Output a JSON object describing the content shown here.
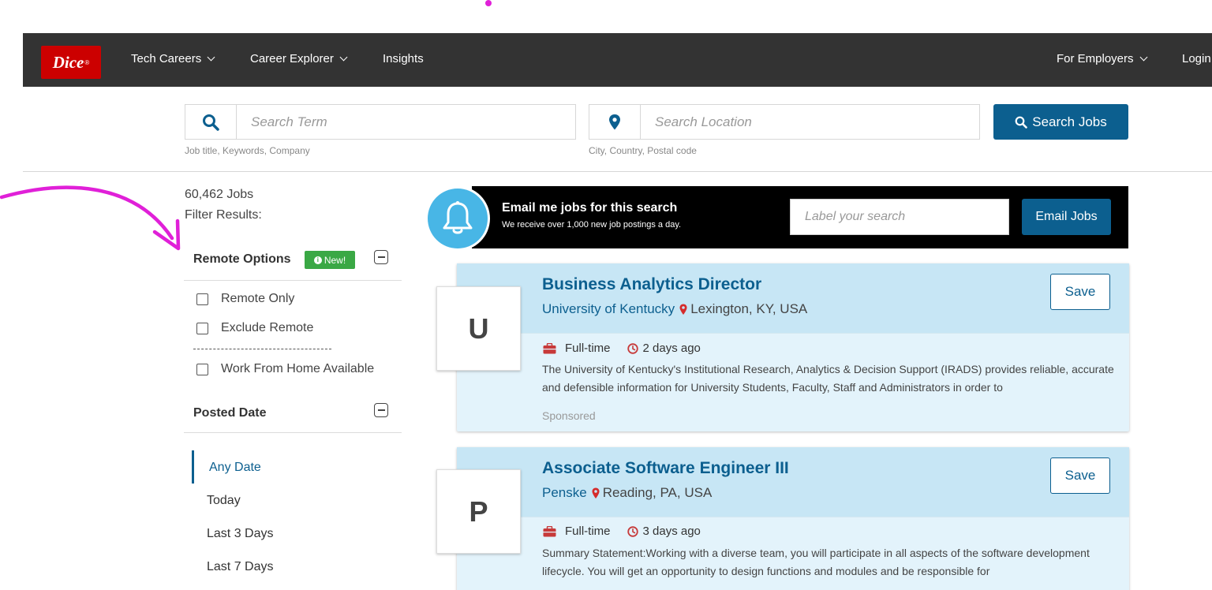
{
  "nav": {
    "logo": "Dice",
    "items": [
      "Tech Careers",
      "Career Explorer",
      "Insights"
    ],
    "right_items": [
      "For Employers",
      "Login"
    ]
  },
  "search": {
    "term_placeholder": "Search Term",
    "term_hint": "Job title, Keywords, Company",
    "location_placeholder": "Search Location",
    "location_hint": "City, Country, Postal code",
    "button_label": "Search Jobs"
  },
  "sidebar": {
    "jobs_count": "60,462 Jobs",
    "filter_label": "Filter Results:",
    "remote": {
      "title": "Remote Options",
      "badge": "New!",
      "options": [
        "Remote Only",
        "Exclude Remote",
        "Work From Home Available"
      ]
    },
    "posted": {
      "title": "Posted Date",
      "options": [
        "Any Date",
        "Today",
        "Last 3 Days",
        "Last 7 Days"
      ],
      "selected": "Any Date"
    }
  },
  "email_alert": {
    "title": "Email me jobs for this search",
    "subtitle": "We receive over 1,000 new job postings a day.",
    "input_placeholder": "Label your search",
    "button_label": "Email Jobs"
  },
  "jobs": [
    {
      "logo_letter": "U",
      "title": "Business Analytics Director",
      "company": "University of Kentucky",
      "location": "Lexington, KY, USA",
      "type": "Full-time",
      "posted": "2 days ago",
      "description": "The University of Kentucky's Institutional Research, Analytics & Decision Support (IRADS) provides reliable, accurate and defensible information for University Students, Faculty, Staff and Administrators in order to",
      "sponsored": "Sponsored",
      "save_label": "Save"
    },
    {
      "logo_letter": "P",
      "title": "Associate Software Engineer III",
      "company": "Penske",
      "location": "Reading, PA, USA",
      "type": "Full-time",
      "posted": "3 days ago",
      "description": "Summary Statement:Working with a diverse team, you will participate in all aspects of the software development lifecycle. You will get an opportunity to design functions and modules and be responsible for",
      "save_label": "Save"
    }
  ],
  "colors": {
    "brand_red": "#cc0000",
    "primary_blue": "#0c5f8f",
    "nav_bg": "#333333",
    "annotation_pink": "#e020d8",
    "new_badge_green": "#3aa845"
  }
}
